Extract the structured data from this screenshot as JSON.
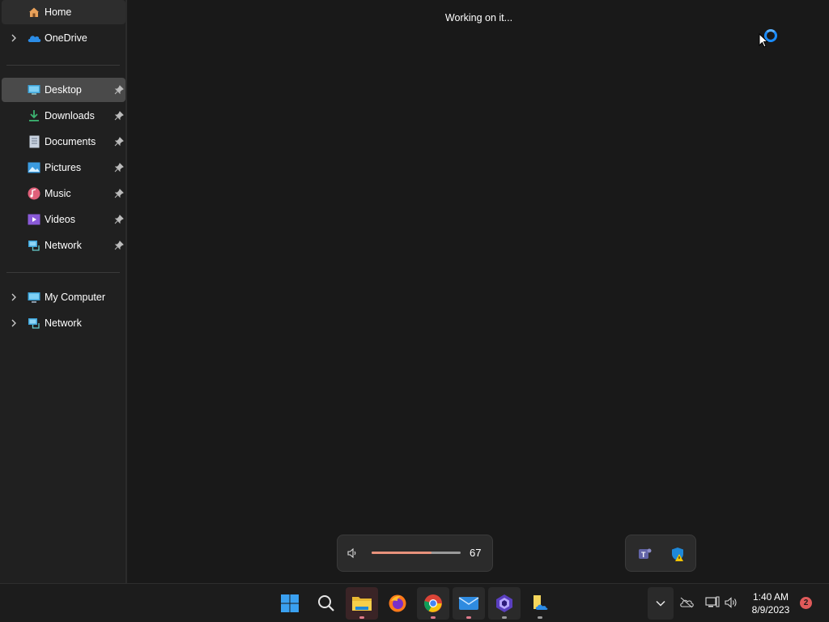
{
  "sidebar": {
    "home": {
      "label": "Home"
    },
    "onedrive": {
      "label": "OneDrive"
    },
    "quick_access": [
      {
        "label": "Desktop",
        "icon": "desktop-icon"
      },
      {
        "label": "Downloads",
        "icon": "downloads-icon"
      },
      {
        "label": "Documents",
        "icon": "documents-icon"
      },
      {
        "label": "Pictures",
        "icon": "pictures-icon"
      },
      {
        "label": "Music",
        "icon": "music-icon"
      },
      {
        "label": "Videos",
        "icon": "videos-icon"
      },
      {
        "label": "Network",
        "icon": "network-icon"
      }
    ],
    "tree": [
      {
        "label": "My Computer",
        "icon": "computer-icon"
      },
      {
        "label": "Network",
        "icon": "network-icon"
      }
    ]
  },
  "main": {
    "status": "Working on it..."
  },
  "volume_flyout": {
    "value": "67",
    "level_percent": 67,
    "accent": "#e8927c"
  },
  "taskbar": {
    "apps": [
      "windows-start",
      "search",
      "file-explorer",
      "firefox",
      "chrome",
      "mail",
      "clipchamp",
      "notepad-cloud"
    ],
    "clock_time": "1:40 AM",
    "clock_date": "8/9/2023",
    "notification_count": "2"
  },
  "colors": {
    "background": "#191919",
    "sidebar": "#202020",
    "selected": "#4a4a4a",
    "accent_blue": "#1a8cff"
  }
}
